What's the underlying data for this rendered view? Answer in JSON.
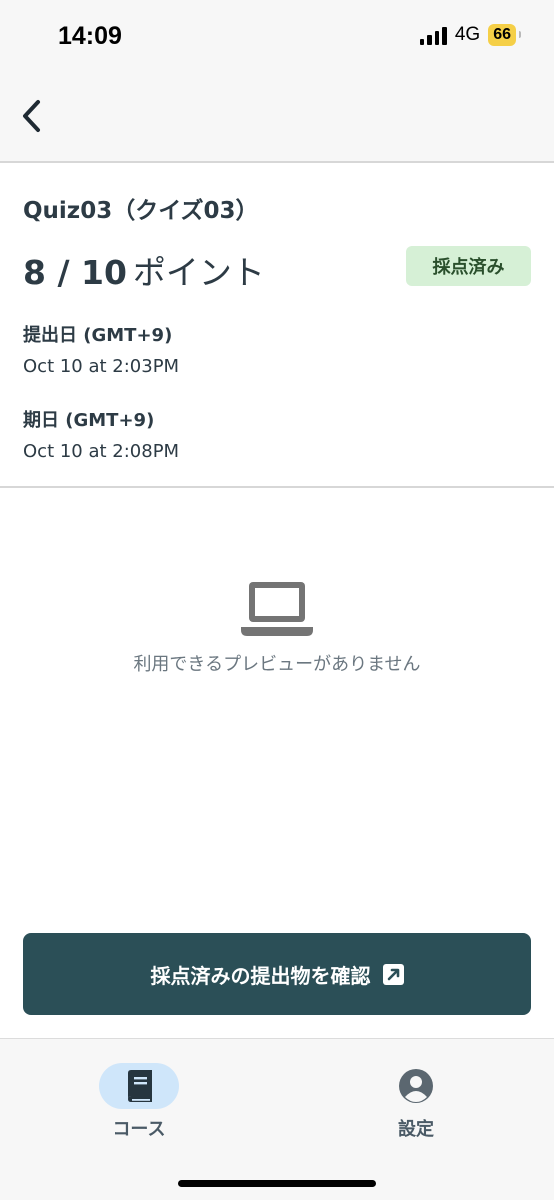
{
  "status_bar": {
    "time": "14:09",
    "network": "4G",
    "battery": "66",
    "battery_color": "#f5cf47"
  },
  "nav": {
    "back_icon": "chevron-left-icon"
  },
  "submission": {
    "title": "Quiz03（クイズ03）",
    "score": "8 / 10",
    "score_unit": "ポイント",
    "status": "採点済み",
    "status_color": "#d6f0d6",
    "submitted_label": "提出日 (GMT+9)",
    "submitted_value": "Oct 10 at 2:03PM",
    "due_label": "期日 (GMT+9)",
    "due_value": "Oct 10 at 2:08PM"
  },
  "preview": {
    "icon": "laptop-icon",
    "message": "利用できるプレビューがありません"
  },
  "action": {
    "label": "採点済みの提出物を確認",
    "icon": "external-link-icon",
    "color": "#2b4f57"
  },
  "tabs": [
    {
      "label": "コース",
      "icon": "book-icon",
      "selected": true
    },
    {
      "label": "設定",
      "icon": "user-circle-icon",
      "selected": false
    }
  ]
}
